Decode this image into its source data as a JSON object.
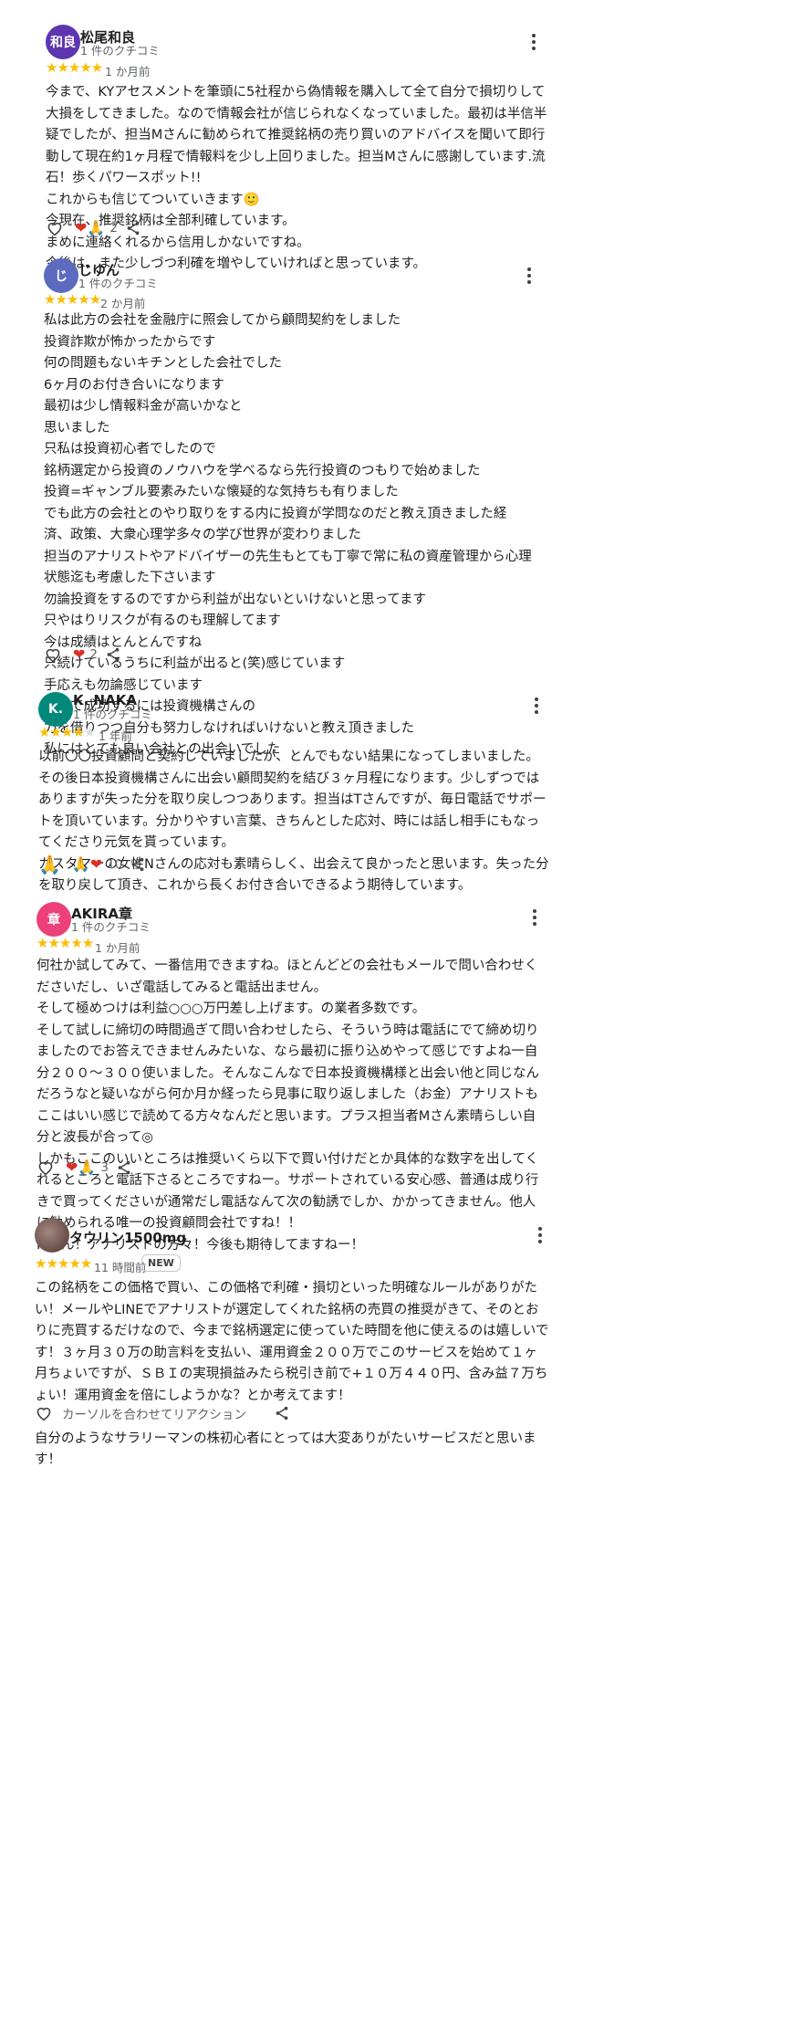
{
  "colors": {
    "star": "#fbbc04",
    "star_empty": "#dadce0",
    "heart": "#d93025"
  },
  "reviews": [
    {
      "author": "松尾和良",
      "avatar_text": "和良",
      "avatar_color": "#5e35b1",
      "review_count": "1 件のクチコミ",
      "rating": 5,
      "time": "1 か月前",
      "text": "今まで、KYアセスメントを筆頭に5社程から偽情報を購入して全て自分で損切りして大損をしてきました。なので情報会社が信じられなくなっていました。最初は半信半疑でしたが、担当Mさんに勧められて推奨銘柄の売り買いのアドバイスを聞いて即行動して現在約1ヶ月程で情報料を少し上回りました。担当Mさんに感謝しています.流石！歩くパワースポット!!\nこれからも信じてついていきます🙂\n今現在、推奨銘柄は全部利確しています。\nまめに連絡くれるから信用しかないですね。\n今後は、また少しづつ利確を増やしていければと思っています。",
      "reactions": "❤🙏",
      "reaction_count": "2"
    },
    {
      "author": "じゆん",
      "avatar_text": "じ",
      "avatar_color": "#5c6bc0",
      "review_count": "1 件のクチコミ",
      "rating": 5,
      "time": "2 か月前",
      "text": "私は此方の会社を金融庁に照会してから顧問契約をしました\n投資詐欺が怖かったからです\n何の問題もないキチンとした会社でした\n6ヶ月のお付き合いになります\n最初は少し情報料金が高いかなと\n思いました\n只私は投資初心者でしたので\n銘柄選定から投資のノウハウを学べるなら先行投資のつもりで始めました\n投資=ギャンブル要素みたいな懐疑的な気持ちも有りました\nでも此方の会社とのやり取りをする内に投資が学問なのだと教え頂きました経済、政策、大衆心理学多々の学び世界が変わりました\n担当のアナリストやアドバイザーの先生もとても丁寧で常に私の資産管理から心理状態迄も考慮した下さいます\n勿論投資をするのですから利益が出ないといけないと思ってます\n只やはりリスクが有るのも理解してます\n今は成績はとんとんですね\n只続けているうちに利益が出ると(笑)感じています\n手応えも勿論感じています\n投資で成功するには投資機構さんの\n力を借りつつ自分も努力しなければいけないと教え頂きました\n私にはとても良い会社との出会いでした",
      "reactions": "❤",
      "reaction_count": "2"
    },
    {
      "author": "K. NAKA",
      "avatar_text": "K.",
      "avatar_color": "#00897b",
      "review_count": "1 件のクチコミ",
      "rating": 4,
      "time": "1 年前",
      "text": "以前〇〇投資顧問と契約していましたが、とんでもない結果になってしまいました。その後日本投資機構さんに出会い顧問契約を結び３ヶ月程になります。少しずつではありますが失った分を取り戻しつつあります。担当はTさんですが、毎日電話でサポートを頂いています。分かりやすい言葉、きちんとした応対、時には話し相手にもなってくださり元気を貰っています。\nカスタマーの女性Nさんの応対も素晴らしく、出会えて良かったと思います。失った分を取り戻して頂き、これから長くお付き合いできるよう期待しています。",
      "reactions": "🙏❤",
      "reaction_count": "10"
    },
    {
      "author": "AKIRA章",
      "avatar_text": "章",
      "avatar_color": "#ec407a",
      "review_count": "1 件のクチコミ",
      "rating": 5,
      "time": "1 か月前",
      "text": "何社か試してみて、一番信用できますね。ほとんどどの会社もメールで問い合わせくださいだし、いざ電話してみると電話出ません。\nそして極めつけは利益○○○万円差し上げます。の業者多数です。\nそして試しに締切の時間過ぎて問い合わせしたら、そういう時は電話にでて締め切りましたのでお答えできませんみたいな、なら最初に振り込めやって感じですよね一自分２００～３００使いました。そんなこんなで日本投資機構様と出会い他と同じなんだろうなと疑いながら何か月か経ったら見事に取り返しました（お金）アナリストもここはいい感じで読めてる方々なんだと思います。プラス担当者Mさん素晴らしい自分と波長が合って◎\nしかもここのいいところは推奨いくら以下で買い付けだとか具体的な数字を出してくれるところと電話下さるところですねー。サポートされている安心感、普通は成り行きで買ってくださいが通常だし電話なんて次の勧誘でしか、かかってきません。他人に勧められる唯一の投資顧問会社ですね！！\nMさん！アナリストの方々！今後も期待してますねー！",
      "reactions": "❤🙏",
      "reaction_count": "3"
    },
    {
      "author": "タウリン1500mg",
      "avatar_text": "",
      "avatar_color": "#6d4c41",
      "review_count": "",
      "rating": 5,
      "time": "11 時間前",
      "badge": "NEW",
      "text": "この銘柄をこの価格で買い、この価格で利確・損切といった明確なルールがありがたい！メールやLINEでアナリストが選定してくれた銘柄の売買の推奨がきて、そのとおりに売買するだけなので、今まで銘柄選定に使っていた時間を他に使えるのは嬉しいです！３ヶ月３０万の助言料を支払い、運用資金２００万でこのサービスを始めて１ヶ月ちょいですが、ＳＢＩの実現損益みたら税引き前で+１０万４４０円、含み益７万ちょい！運用資金を倍にしようかな？とか考えてます！\n\n自分のようなサラリーマンの株初心者にとっては大変ありがたいサービスだと思います！",
      "reaction_hint": "カーソルを合わせてリアクション"
    }
  ]
}
